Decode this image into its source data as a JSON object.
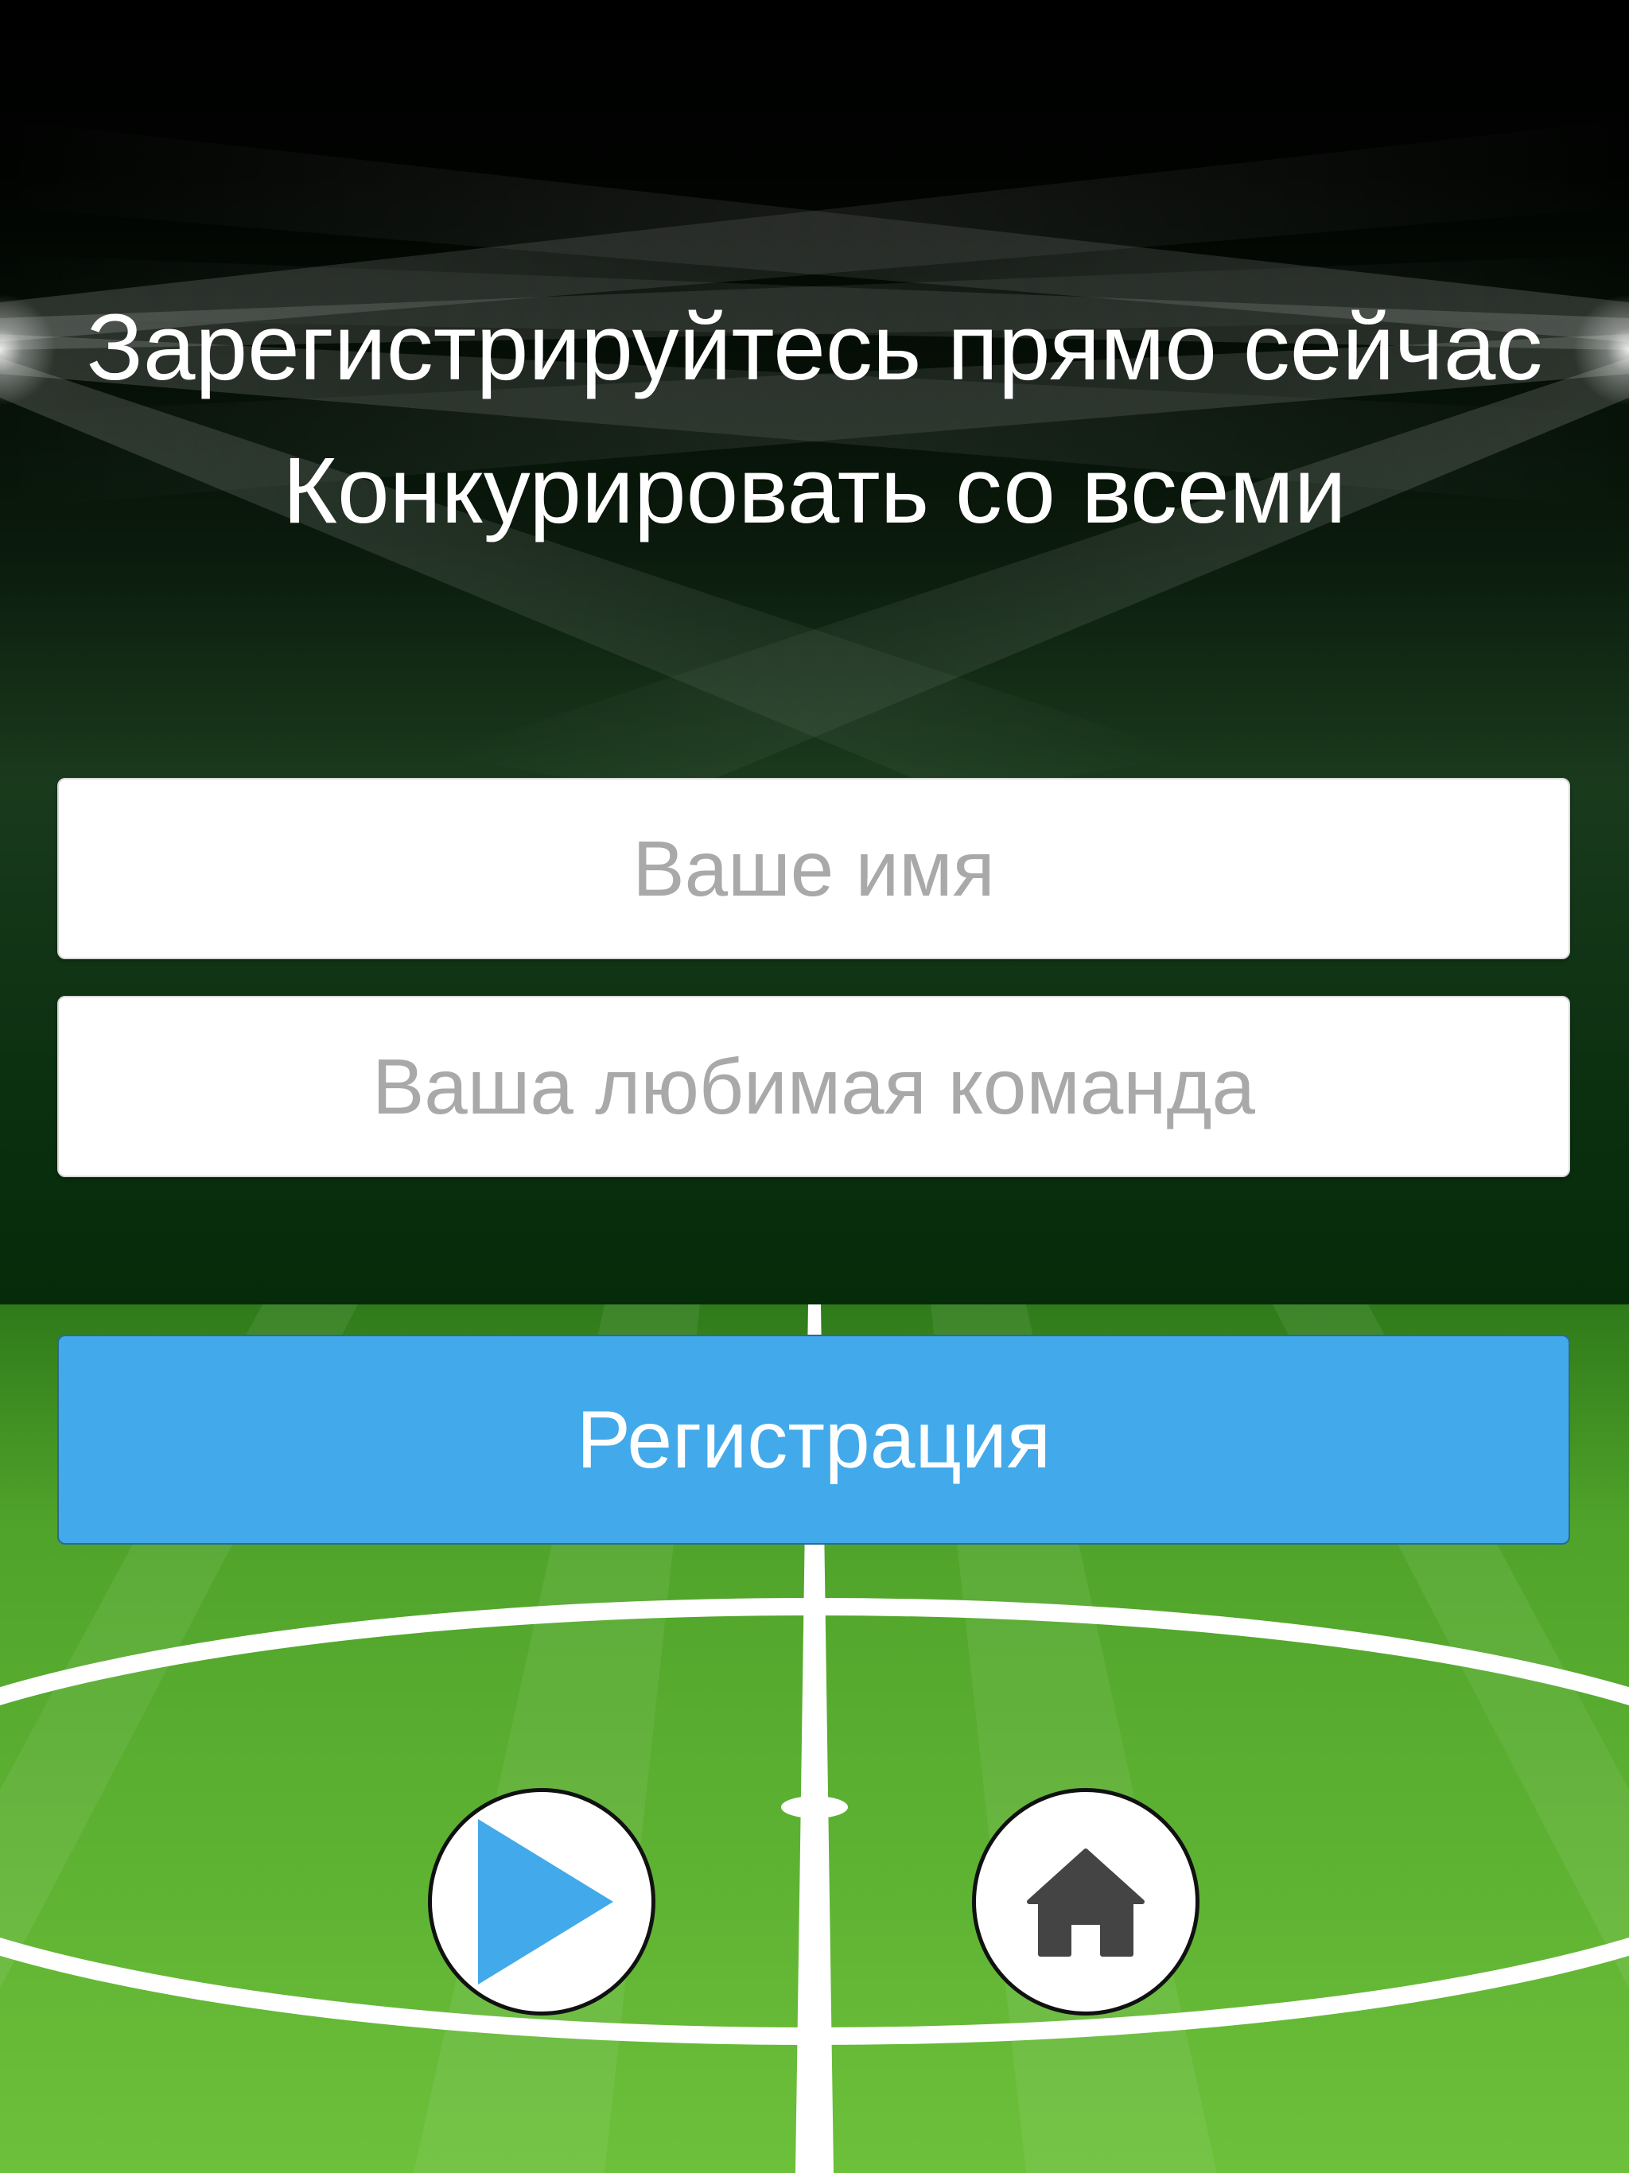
{
  "header": {
    "title_line1": "Зарегистрируйтесь прямо сейчас",
    "title_line2": "Конкурировать со всеми"
  },
  "form": {
    "name_placeholder": "Ваше имя",
    "team_placeholder": "Ваша любимая команда",
    "register_label": "Регистрация"
  },
  "controls": {
    "play_icon": "play-icon",
    "home_icon": "home-icon"
  },
  "colors": {
    "accent": "#42a9ea",
    "field_green_light": "#6cc03a",
    "field_green_dark": "#4fa32a",
    "stadium_dark": "#062a0a",
    "home_icon": "#444444"
  }
}
